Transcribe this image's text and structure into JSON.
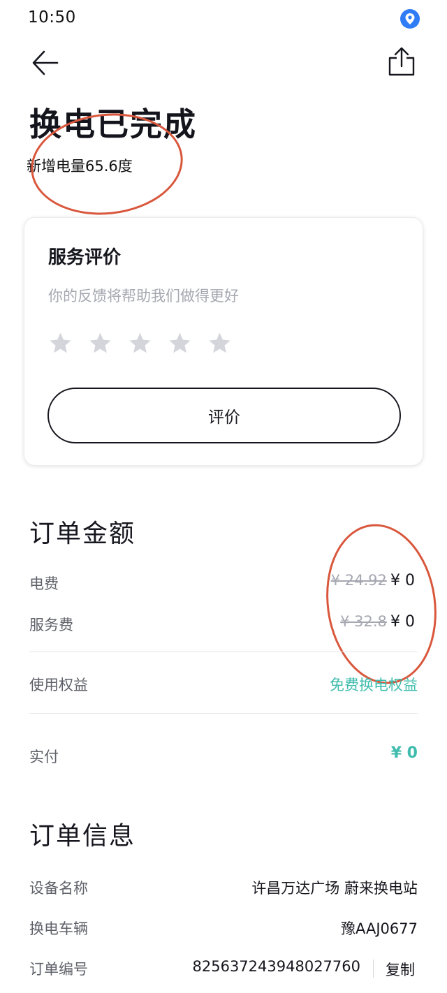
{
  "status_bar": {
    "time": "10:50"
  },
  "header": {
    "title": "换电已完成",
    "energy_added": "新增电量65.6度"
  },
  "review": {
    "title": "服务评价",
    "subtitle": "你的反馈将帮助我们做得更好",
    "rating": 0,
    "max_rating": 5,
    "button_label": "评价"
  },
  "order_amount": {
    "title": "订单金额",
    "electricity": {
      "label": "电费",
      "original": "¥ 24.92",
      "price": "¥ 0"
    },
    "service": {
      "label": "服务费",
      "original": "¥ 32.8",
      "price": "¥ 0"
    },
    "benefit": {
      "label": "使用权益",
      "value": "免费换电权益"
    },
    "paid": {
      "label": "实付",
      "value": "¥ 0"
    }
  },
  "order_info": {
    "title": "订单信息",
    "device": {
      "label": "设备名称",
      "value": "许昌万达广场 蔚来换电站"
    },
    "vehicle": {
      "label": "换电车辆",
      "value": "豫AAJ0677"
    },
    "order_no": {
      "label": "订单编号",
      "value": "825637243948027760",
      "copy_label": "复制"
    }
  },
  "colors": {
    "accent": "#3fbcad",
    "annotation": "#d9573c",
    "location": "#2f7cf6",
    "star": "#d3d5db"
  }
}
